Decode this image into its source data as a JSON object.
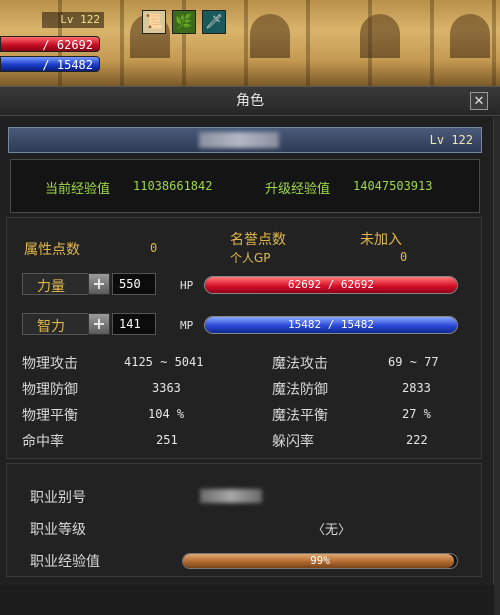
{
  "hud": {
    "level": "Lv 122",
    "hp": "/ 62692",
    "mp": "/ 15482",
    "skill_icons": [
      "scroll-icon",
      "herb-icon",
      "sword-icon"
    ]
  },
  "window": {
    "title": "角色",
    "close_glyph": "✕"
  },
  "character": {
    "level": "Lv 122"
  },
  "experience": {
    "current_label": "当前经验值",
    "current_value": "11038661842",
    "next_label": "升级经验值",
    "next_value": "14047503913"
  },
  "points": {
    "attr_label": "属性点数",
    "attr_value": "0",
    "honor_label": "名誉点数",
    "honor_value": "未加入",
    "gp_label": "个人GP",
    "gp_value": "0"
  },
  "stats": {
    "str_label": "力量",
    "str_value": "550",
    "int_label": "智力",
    "int_value": "141",
    "plus_glyph": "+"
  },
  "bars": {
    "hp_tag": "HP",
    "hp_text": "62692 / 62692",
    "hp_fraction": 1.0,
    "mp_tag": "MP",
    "mp_text": "15482 / 15482",
    "mp_fraction": 1.0
  },
  "combat": {
    "phys_atk_label": "物理攻击",
    "phys_atk_value": "4125 ~ 5041",
    "mag_atk_label": "魔法攻击",
    "mag_atk_value": "69 ~ 77",
    "phys_def_label": "物理防御",
    "phys_def_value": "3363",
    "mag_def_label": "魔法防御",
    "mag_def_value": "2833",
    "phys_bal_label": "物理平衡",
    "phys_bal_value": "104 %",
    "mag_bal_label": "魔法平衡",
    "mag_bal_value": "27 %",
    "hit_label": "命中率",
    "hit_value": "251",
    "dodge_label": "躲闪率",
    "dodge_value": "222"
  },
  "job": {
    "alias_label": "职业别号",
    "level_label": "职业等级",
    "level_value": "〈无〉",
    "exp_label": "职业经验值",
    "exp_text": "99%",
    "exp_fraction": 0.99
  },
  "colors": {
    "accent_gold": "#e0b84a",
    "exp_green": "#9fd84a",
    "hp_red": "#d8102a",
    "mp_blue": "#2848d8"
  }
}
